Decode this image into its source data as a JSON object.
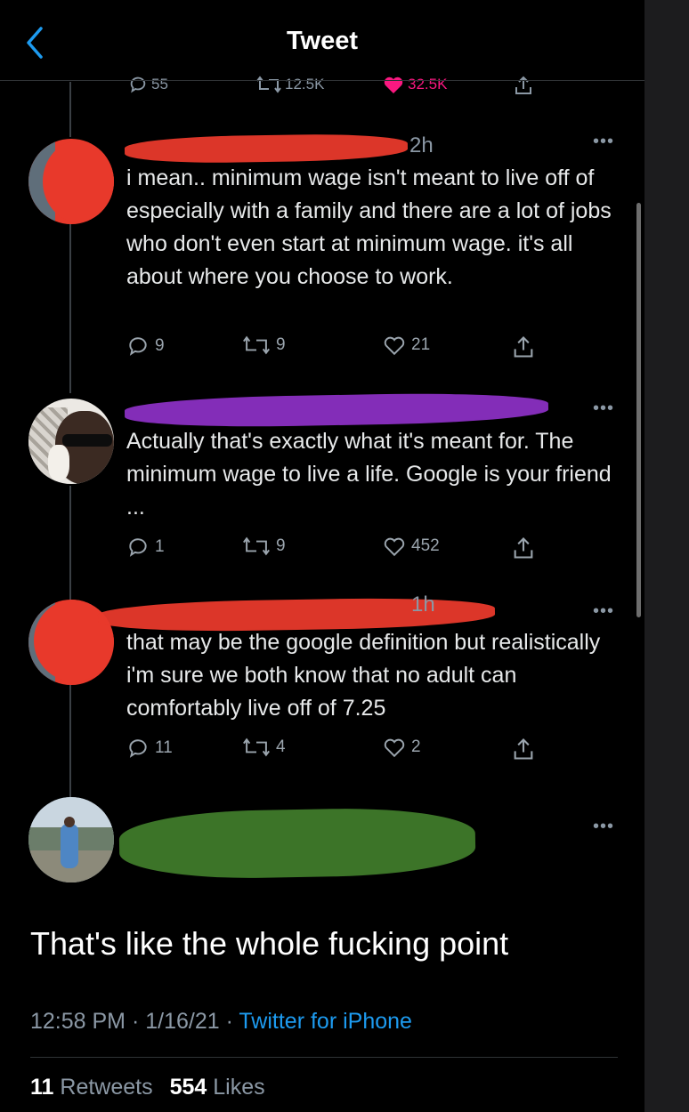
{
  "header": {
    "title": "Tweet"
  },
  "top_actions": {
    "replies": "55",
    "retweets": "12.5K",
    "likes": "32.5K"
  },
  "replies": [
    {
      "time": "2h",
      "text": "i mean.. minimum wage isn't meant to live off of especially with a family and there are a lot of jobs who don't even start at minimum wage. it's all about where you choose to work.",
      "reply_count": "9",
      "retweet_count": "9",
      "like_count": "21",
      "redaction_color": "#e8392b"
    },
    {
      "time": "",
      "text": "Actually that's exactly what it's meant for. The minimum wage to live a life. Google is your friend ...",
      "reply_count": "1",
      "retweet_count": "9",
      "like_count": "452",
      "redaction_color": "#8a2fc2"
    },
    {
      "time": "1h",
      "text": "that may be the google definition but realistically i'm sure we both know that no adult can comfortably live off of 7.25",
      "reply_count": "11",
      "retweet_count": "4",
      "like_count": "2",
      "redaction_color": "#e8392b"
    }
  ],
  "main_tweet": {
    "redaction_color": "#3f7a2a",
    "text": "That's like the whole fucking point",
    "timestamp": "12:58 PM · 1/16/21 · ",
    "source": "Twitter for iPhone",
    "retweets_count": "11",
    "retweets_label": "Retweets",
    "likes_count": "554",
    "likes_label": "Likes"
  },
  "colors": {
    "background": "#000000",
    "text": "#e7e9ea",
    "muted": "#8b98a5",
    "link": "#1d9bf0",
    "like": "#f91880"
  },
  "icons": [
    "back-chevron-icon",
    "reply-icon",
    "retweet-icon",
    "heart-icon",
    "share-icon",
    "more-icon"
  ]
}
